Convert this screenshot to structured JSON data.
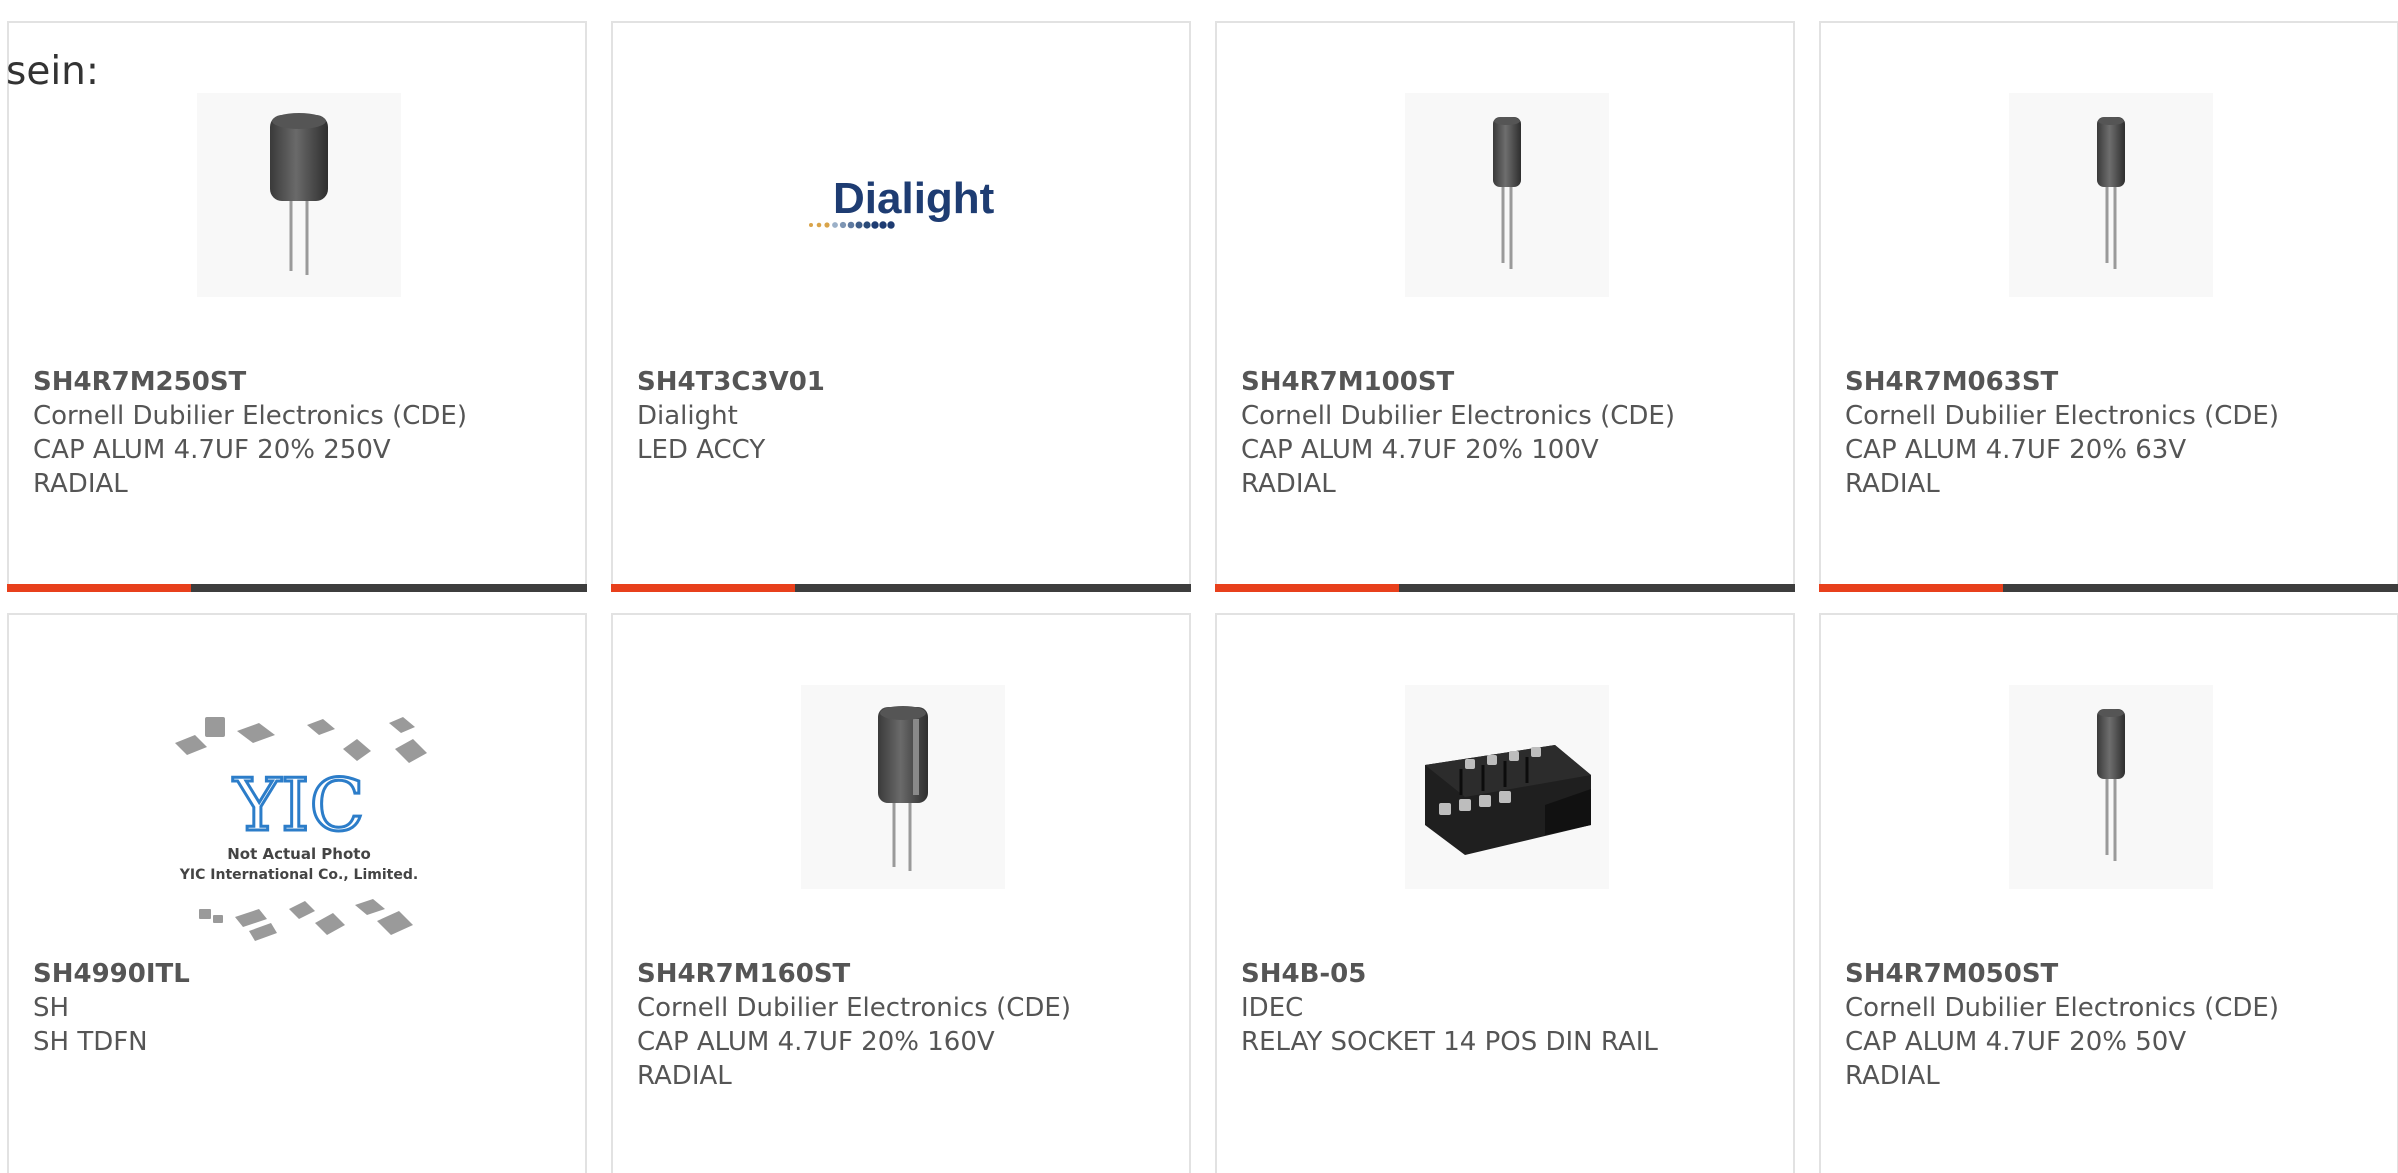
{
  "heading": "sein:",
  "colors": {
    "accent": "#e8401c",
    "bar": "#3d3d3d",
    "border": "#e2e2e2",
    "text": "#555555"
  },
  "products": [
    {
      "part_number": "SH4R7M250ST",
      "manufacturer": "Cornell Dubilier Electronics (CDE)",
      "description_1": "CAP ALUM 4.7UF 20% 250V",
      "description_2": "RADIAL",
      "image": "capacitor-large-icon"
    },
    {
      "part_number": "SH4T3C3V01",
      "manufacturer": "Dialight",
      "description_1": "LED ACCY",
      "description_2": "",
      "image": "dialight-logo",
      "logo_text": "Dialight"
    },
    {
      "part_number": "SH4R7M100ST",
      "manufacturer": "Cornell Dubilier Electronics (CDE)",
      "description_1": "CAP ALUM 4.7UF 20% 100V",
      "description_2": "RADIAL",
      "image": "capacitor-small-icon"
    },
    {
      "part_number": "SH4R7M063ST",
      "manufacturer": "Cornell Dubilier Electronics (CDE)",
      "description_1": "CAP ALUM 4.7UF 20% 63V",
      "description_2": "RADIAL",
      "image": "capacitor-small-icon"
    },
    {
      "part_number": "SH4990ITL",
      "manufacturer": "SH",
      "description_1": "SH TDFN",
      "description_2": "",
      "image": "yic-not-actual-photo",
      "photo_note_1": "Not Actual Photo",
      "photo_note_2": "YIC International Co., Limited.",
      "logo_text": "YIC"
    },
    {
      "part_number": "SH4R7M160ST",
      "manufacturer": "Cornell Dubilier Electronics (CDE)",
      "description_1": "CAP ALUM 4.7UF 20% 160V",
      "description_2": "RADIAL",
      "image": "capacitor-large-icon"
    },
    {
      "part_number": "SH4B-05",
      "manufacturer": "IDEC",
      "description_1": "RELAY SOCKET 14 POS DIN RAIL",
      "description_2": "",
      "image": "relay-socket-icon"
    },
    {
      "part_number": "SH4R7M050ST",
      "manufacturer": "Cornell Dubilier Electronics (CDE)",
      "description_1": "CAP ALUM 4.7UF 20% 50V",
      "description_2": "RADIAL",
      "image": "capacitor-small-icon"
    }
  ]
}
